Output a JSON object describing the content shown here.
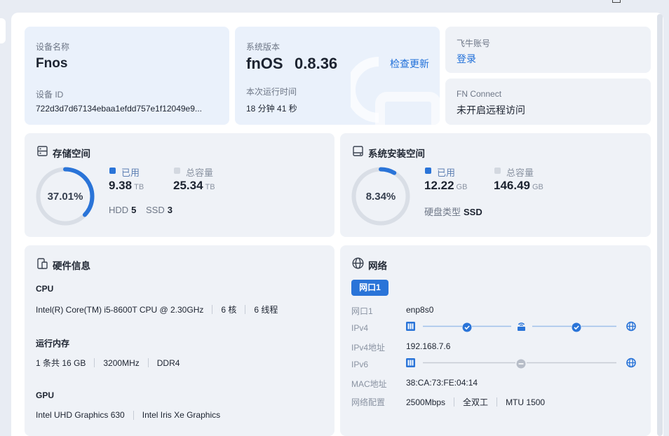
{
  "device": {
    "name_label": "设备名称",
    "name": "Fnos",
    "id_label": "设备 ID",
    "id": "722d3d7d67134ebaa1efdd757e1f12049e9..."
  },
  "system": {
    "version_label": "系统版本",
    "os_name": "fnOS",
    "version": "0.8.36",
    "check_update": "检查更新",
    "uptime_label": "本次运行时间",
    "uptime": "18 分钟 41 秒"
  },
  "account": {
    "label": "飞牛账号",
    "login": "登录"
  },
  "fn_connect": {
    "label": "FN Connect",
    "status": "未开启远程访问"
  },
  "storage": {
    "title": "存储空间",
    "percent_text": "37.01%",
    "percent": 37.01,
    "used_label": "已用",
    "used": "9.38",
    "used_unit": "TB",
    "total_label": "总容量",
    "total": "25.34",
    "total_unit": "TB",
    "hdd_label": "HDD",
    "hdd_count": "5",
    "ssd_label": "SSD",
    "ssd_count": "3"
  },
  "sys_space": {
    "title": "系统安装空间",
    "percent_text": "8.34%",
    "percent": 8.34,
    "used_label": "已用",
    "used": "12.22",
    "used_unit": "GB",
    "total_label": "总容量",
    "total": "146.49",
    "total_unit": "GB",
    "disk_type_label": "硬盘类型",
    "disk_type": "SSD"
  },
  "hardware": {
    "title": "硬件信息",
    "cpu_label": "CPU",
    "cpu_model": "Intel(R) Core(TM) i5-8600T CPU @ 2.30GHz",
    "cpu_cores": "6 核",
    "cpu_threads": "6 线程",
    "mem_label": "运行内存",
    "mem_size": "1 条共 16 GB",
    "mem_speed": "3200MHz",
    "mem_type": "DDR4",
    "gpu_label": "GPU",
    "gpu1": "Intel UHD Graphics 630",
    "gpu2": "Intel Iris Xe Graphics"
  },
  "network": {
    "title": "网络",
    "tab": "网口1",
    "port_label": "网口1",
    "port": "enp8s0",
    "ipv4_label": "IPv4",
    "ipv4_addr_label": "IPv4地址",
    "ipv4_addr": "192.168.7.6",
    "ipv6_label": "IPv6",
    "mac_label": "MAC地址",
    "mac": "38:CA:73:FE:04:14",
    "config_label": "网络配置",
    "speed": "2500Mbps",
    "duplex": "全双工",
    "mtu": "MTU 1500"
  },
  "colors": {
    "accent": "#1f6fd9",
    "ring_track": "#d9dee6",
    "legend_used": "#2a74d8",
    "legend_total": "#d3d8e0"
  }
}
